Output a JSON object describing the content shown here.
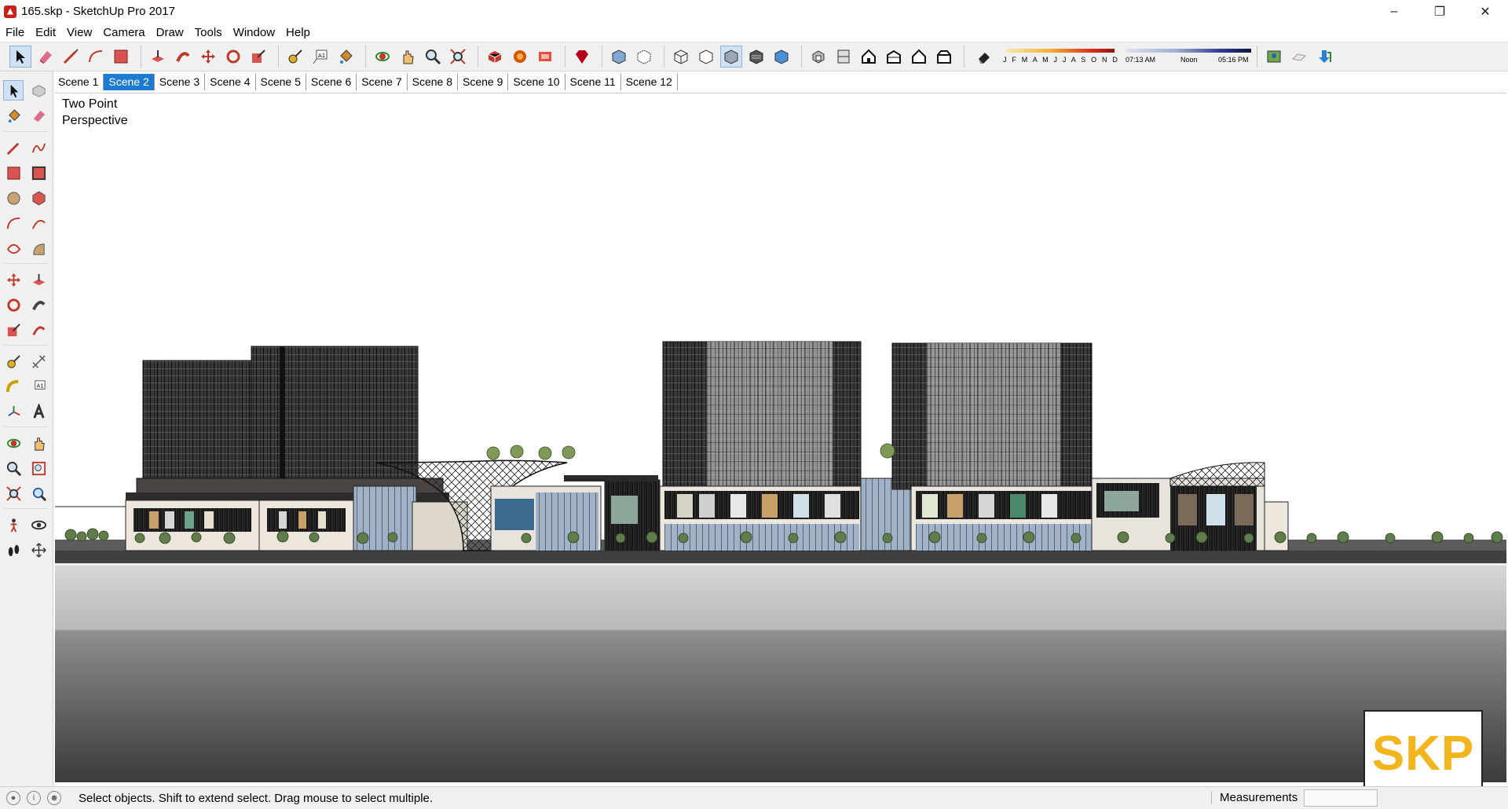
{
  "window": {
    "title": "165.skp - SketchUp Pro 2017",
    "controls": [
      "minimize-icon",
      "restore-icon",
      "close-icon"
    ]
  },
  "menu": [
    "File",
    "Edit",
    "View",
    "Camera",
    "Draw",
    "Tools",
    "Window",
    "Help"
  ],
  "toolbar": {
    "icons": [
      "select-icon",
      "eraser-icon",
      "line-icon",
      "arc-icon",
      "rectangle-icon",
      "push-pull-icon",
      "follow-me-icon",
      "move-icon",
      "rotate-icon",
      "scale-icon",
      "tape-measure-icon",
      "text-icon",
      "paint-bucket-icon",
      "orbit-icon",
      "pan-icon",
      "zoom-icon",
      "zoom-extents-icon",
      "components-icon",
      "3d-warehouse-icon",
      "extension-warehouse-icon",
      "ruby-icon",
      "xray-icon",
      "back-edges-icon",
      "wireframe-icon",
      "hidden-line-icon",
      "shaded-icon",
      "shaded-textures-icon",
      "monochrome-icon",
      "iso-icon",
      "top-view-icon",
      "front-view-icon",
      "right-view-icon",
      "back-view-icon",
      "left-view-icon",
      "shadows-icon",
      "geo-location-icon",
      "sandbox-icon",
      "download-icon"
    ],
    "months": "J F M A M J J A S O N D",
    "time_start": "07:13 AM",
    "time_mid": "Noon",
    "time_end": "05:16 PM"
  },
  "scenes": {
    "tabs": [
      "Scene 1",
      "Scene 2",
      "Scene 3",
      "Scene 4",
      "Scene 5",
      "Scene 6",
      "Scene 7",
      "Scene 8",
      "Scene 9",
      "Scene 10",
      "Scene 11",
      "Scene 12"
    ],
    "active": "Scene 2"
  },
  "viewport": {
    "camera_line1": "Two Point",
    "camera_line2": "Perspective"
  },
  "logo": {
    "text": "SKP",
    "color": "#f2b51e"
  },
  "status": {
    "hint": "Select objects. Shift to extend select. Drag mouse to select multiple.",
    "measurements_label": "Measurements",
    "measurements_value": ""
  },
  "colors": {
    "accent": "#1e7bd2",
    "toolbar_bg": "#f0f0f0"
  }
}
